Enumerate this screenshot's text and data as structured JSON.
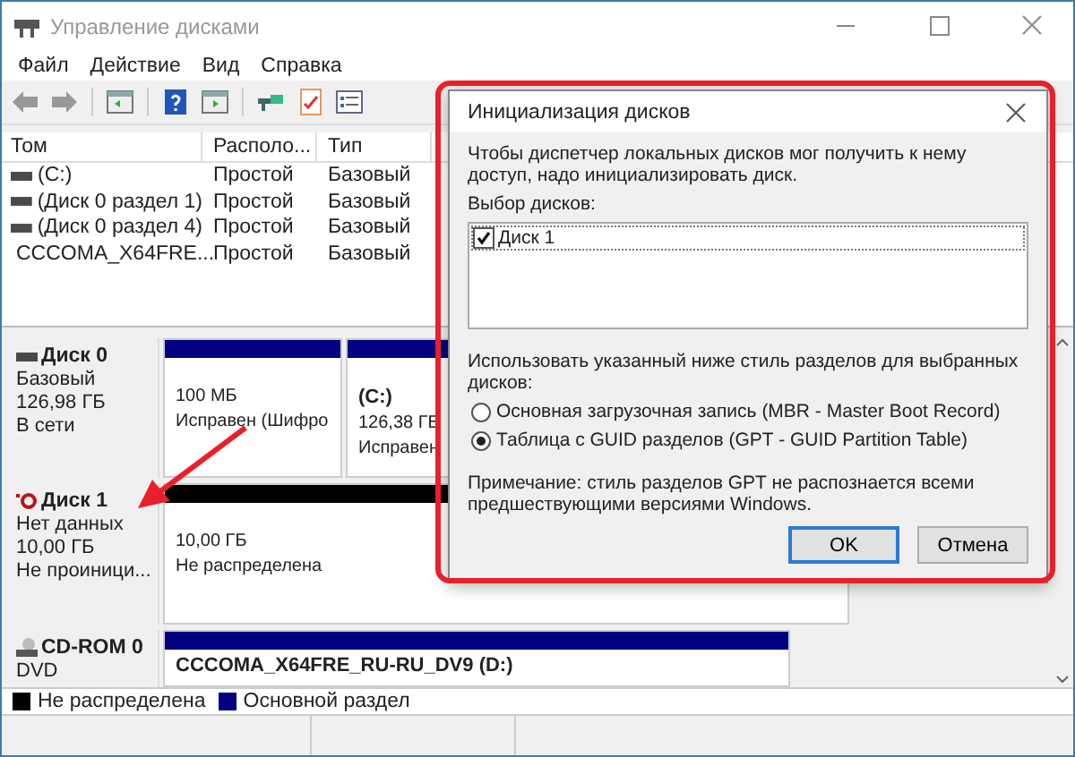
{
  "window": {
    "title": "Управление дисками"
  },
  "menu": [
    "Файл",
    "Действие",
    "Вид",
    "Справка"
  ],
  "volume_table": {
    "columns": [
      "Том",
      "Располо...",
      "Тип"
    ],
    "rows": [
      {
        "kind": "disk",
        "cells": [
          "(C:)",
          "Простой",
          "Базовый"
        ]
      },
      {
        "kind": "disk",
        "cells": [
          "(Диск 0 раздел 1)",
          "Простой",
          "Базовый"
        ]
      },
      {
        "kind": "disk",
        "cells": [
          "(Диск 0 раздел 4)",
          "Простой",
          "Базовый"
        ]
      },
      {
        "kind": "cdrom",
        "cells": [
          "CCCOMA_X64FRE...",
          "Простой",
          "Базовый"
        ]
      }
    ]
  },
  "disks": [
    {
      "kind": "disk",
      "name": "Диск 0",
      "lines": [
        "Базовый",
        "126,98 ГБ",
        "В сети"
      ],
      "partitions": [
        {
          "kind": "primary",
          "lines": [
            "100 МБ",
            "Исправен (Шифро"
          ]
        },
        {
          "kind": "primary",
          "title": "(C:)",
          "lines": [
            "126,38 ГБ",
            "Исправен"
          ]
        }
      ]
    },
    {
      "kind": "uninitialized",
      "name": "Диск 1",
      "lines": [
        "Нет данных",
        "10,00 ГБ",
        "Не проиници..."
      ],
      "partitions": [
        {
          "kind": "unallocated",
          "lines": [
            "10,00 ГБ",
            "Не распределена"
          ]
        }
      ]
    },
    {
      "kind": "cdrom",
      "name": "CD-ROM 0",
      "lines": [
        "DVD"
      ],
      "partitions": [
        {
          "kind": "primary",
          "title": "CCCOMA_X64FRE_RU-RU_DV9 (D:)"
        }
      ]
    }
  ],
  "legend": [
    {
      "label": "Не распределена",
      "color": "#000000"
    },
    {
      "label": "Основной раздел",
      "color": "#000080"
    }
  ],
  "dialog": {
    "title": "Инициализация дисков",
    "message": "Чтобы диспетчер локальных дисков мог получить к нему доступ, надо инициализировать диск.",
    "disk_list_label": "Выбор дисков:",
    "disks": [
      {
        "label": "Диск 1",
        "checked": true
      }
    ],
    "style_label": "Использовать указанный ниже стиль разделов для выбранных дисков:",
    "styles": [
      {
        "label": "Основная загрузочная запись (MBR - Master Boot Record)",
        "selected": false
      },
      {
        "label": "Таблица с GUID разделов (GPT - GUID Partition Table)",
        "selected": true
      }
    ],
    "note": "Примечание: стиль разделов GPT не распознается всеми предшествующими версиями Windows.",
    "buttons": [
      {
        "label": "OK",
        "default": true
      },
      {
        "label": "Отмена",
        "default": false
      }
    ]
  }
}
